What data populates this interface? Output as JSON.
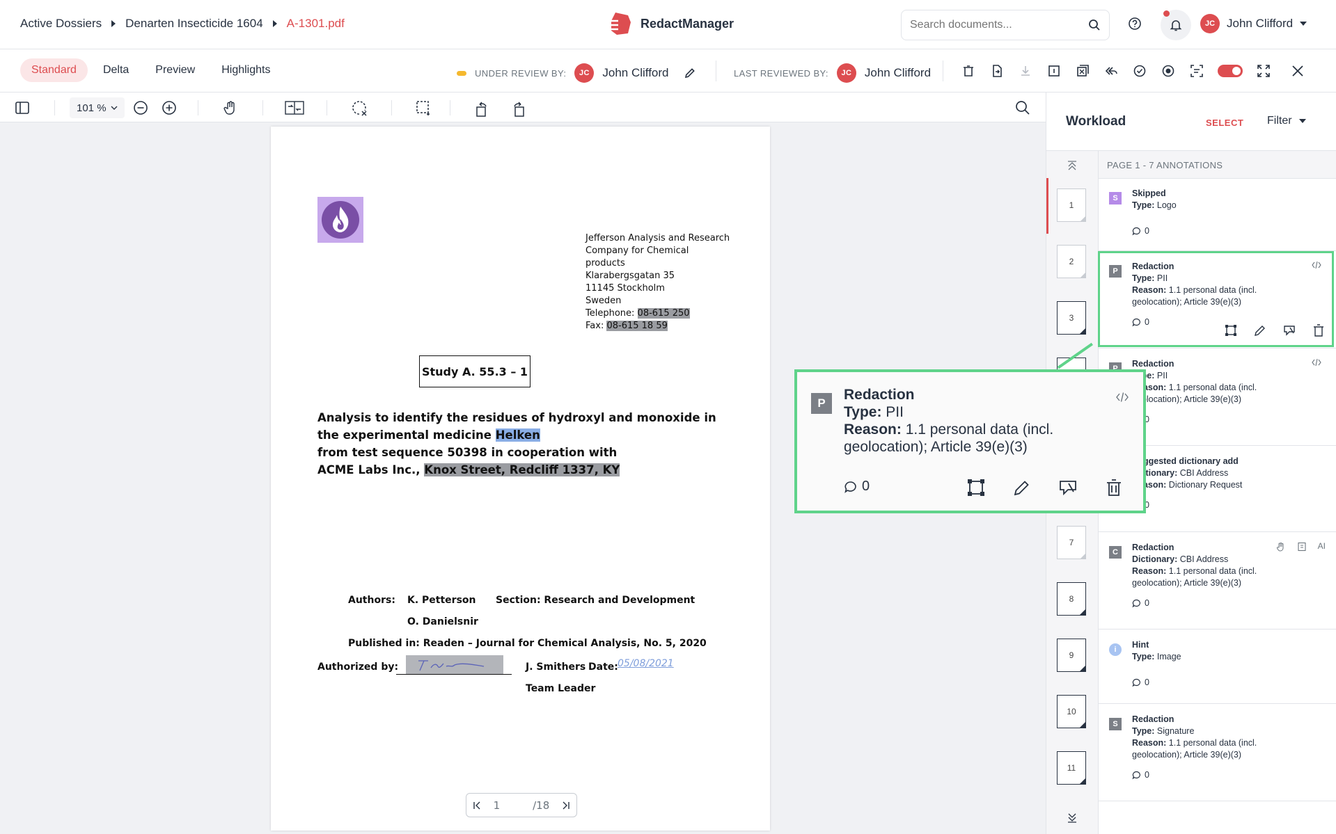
{
  "breadcrumb": [
    "Active Dossiers",
    "Denarten Insecticide 1604",
    "A-1301.pdf"
  ],
  "brand": "RedactManager",
  "search": {
    "placeholder": "Search documents..."
  },
  "user": {
    "initials": "JC",
    "name": "John Clifford"
  },
  "colors": {
    "accent": "#dd4d50",
    "selection": "#5fd38a",
    "skipped": "#b58be8",
    "hint": "#a8c4f2"
  },
  "view_tabs": [
    "Standard",
    "Delta",
    "Preview",
    "Highlights"
  ],
  "active_view_tab": "Standard",
  "review": {
    "under_label": "UNDER REVIEW BY:",
    "under_name": "John Clifford",
    "last_label": "LAST REVIEWED BY:",
    "last_name": "John Clifford"
  },
  "toolbar": {
    "zoom": "101 %"
  },
  "document": {
    "address": [
      "Jefferson Analysis and Research",
      "Company for Chemical",
      "products",
      "Klarabergsgatan 35",
      "11145 Stockholm",
      "Sweden"
    ],
    "telephone_label": "Telephone: ",
    "telephone": "08-615 250",
    "fax_label": "Fax: ",
    "fax": "08-615 18 59",
    "study": "Study A. 55.3 – 1",
    "analysis_line1": "Analysis to identify the residues of hydroxyl and monoxide in",
    "analysis_line2": "the experimental medicine ",
    "analysis_highlight": "Helken",
    "analysis_line3": "from test sequence 50398 in cooperation with",
    "analysis_line4": "ACME Labs Inc., ",
    "analysis_address": "Knox Street, Redcliff 1337, KY",
    "authors_label": "Authors:",
    "author1": "K. Petterson",
    "author2": "O. Danielsnir",
    "section": "Section: Research and Development",
    "published": "Published in: Readen – Journal for Chemical Analysis, No. 5, 2020",
    "authorized_label": "Authorized by:",
    "signer": "J. Smithers",
    "date_label": "Date:",
    "date_value": "05/08/2021",
    "role": "Team Leader"
  },
  "pager": {
    "current": "1",
    "total": "/18"
  },
  "workload": {
    "title": "Workload",
    "select": "SELECT",
    "filter": "Filter",
    "list_header": "PAGE 1 - 7 ANNOTATIONS",
    "thumbnails": [
      "1",
      "2",
      "3",
      "7",
      "8",
      "9",
      "10",
      "11"
    ],
    "annotations": [
      {
        "badge": "S",
        "title": "Skipped",
        "lines": [
          [
            "Type:",
            " Logo"
          ]
        ],
        "comments": "0"
      },
      {
        "badge": "P",
        "title": "Redaction",
        "lines": [
          [
            "Type:",
            " PII"
          ],
          [
            "Reason:",
            " 1.1 personal data (incl. geolocation); Article 39(e)(3)"
          ]
        ],
        "comments": "0"
      },
      {
        "badge": "P",
        "title": "Redaction",
        "lines": [
          [
            "Type:",
            " PII"
          ],
          [
            "Reason:",
            " 1.1 personal data (incl. geolocation); Article 39(e)(3)"
          ]
        ],
        "comments": "0"
      },
      {
        "badge": "D",
        "title": "Suggested dictionary add",
        "lines": [
          [
            "Dictionary:",
            " CBI Address"
          ],
          [
            "Reason:",
            " Dictionary Request"
          ]
        ],
        "comments": "0"
      },
      {
        "badge": "C",
        "title": "Redaction",
        "lines": [
          [
            "Dictionary:",
            " CBI Address"
          ],
          [
            "Reason:",
            " 1.1 personal data (incl. geolocation); Article 39(e)(3)"
          ]
        ],
        "comments": "0",
        "tag": "AI"
      },
      {
        "badge": "i",
        "title": "Hint",
        "lines": [
          [
            "Type:",
            " Image"
          ]
        ],
        "comments": "0"
      },
      {
        "badge": "S",
        "title": "Redaction",
        "lines": [
          [
            "Type:",
            " Signature"
          ],
          [
            "Reason:",
            " 1.1 personal data (incl. geolocation); Article 39(e)(3)"
          ]
        ],
        "comments": "0"
      }
    ]
  },
  "callout": {
    "badge": "P",
    "title": "Redaction",
    "type_label": "Type:",
    "type_value": " PII",
    "reason_label": "Reason:",
    "reason_value": " 1.1 personal data (incl. geolocation); Article 39(e)(3)",
    "comments": "0"
  }
}
